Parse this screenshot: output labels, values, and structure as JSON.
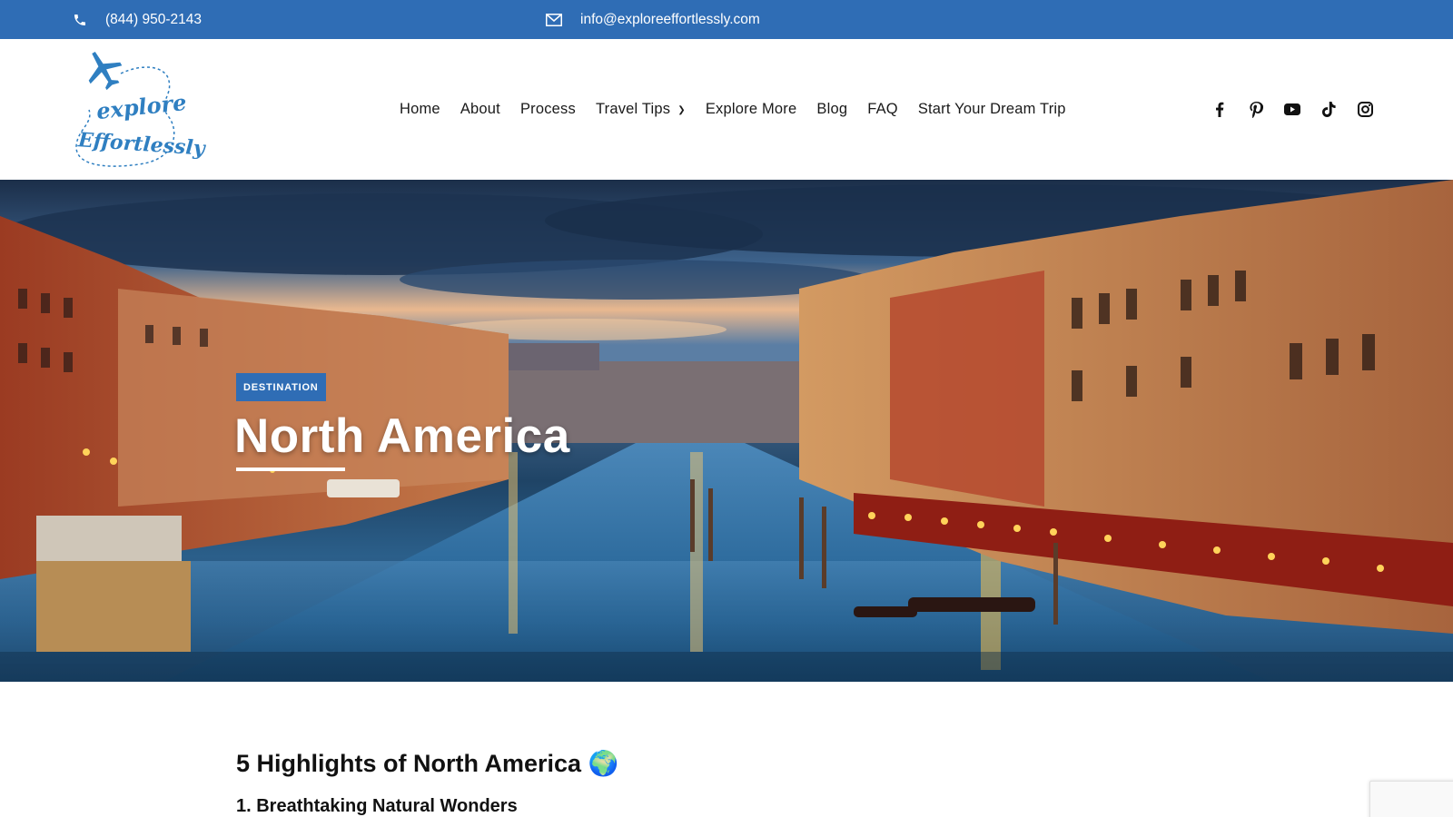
{
  "topbar": {
    "phone": "(844) 950-2143",
    "email": "info@exploreeffortlessly.com",
    "phone_icon": "phone-icon",
    "email_icon": "envelope-icon"
  },
  "logo": {
    "line1": "explore",
    "line2": "Effortlessly"
  },
  "nav": {
    "items": [
      {
        "label": "Home"
      },
      {
        "label": "About"
      },
      {
        "label": "Process"
      },
      {
        "label": "Travel Tips",
        "has_dropdown": true
      },
      {
        "label": "Explore More"
      },
      {
        "label": "Blog"
      },
      {
        "label": "FAQ"
      },
      {
        "label": "Start Your Dream Trip"
      }
    ]
  },
  "social": [
    "facebook-icon",
    "pinterest-icon",
    "youtube-icon",
    "tiktok-icon",
    "instagram-icon"
  ],
  "hero": {
    "badge": "DESTINATION",
    "title": "North America"
  },
  "article": {
    "heading": "5 Highlights of North America 🌍",
    "subheading": "1. Breathtaking Natural Wonders"
  },
  "colors": {
    "brand_blue": "#2f6db5",
    "text_dark": "#111111",
    "white": "#ffffff"
  }
}
